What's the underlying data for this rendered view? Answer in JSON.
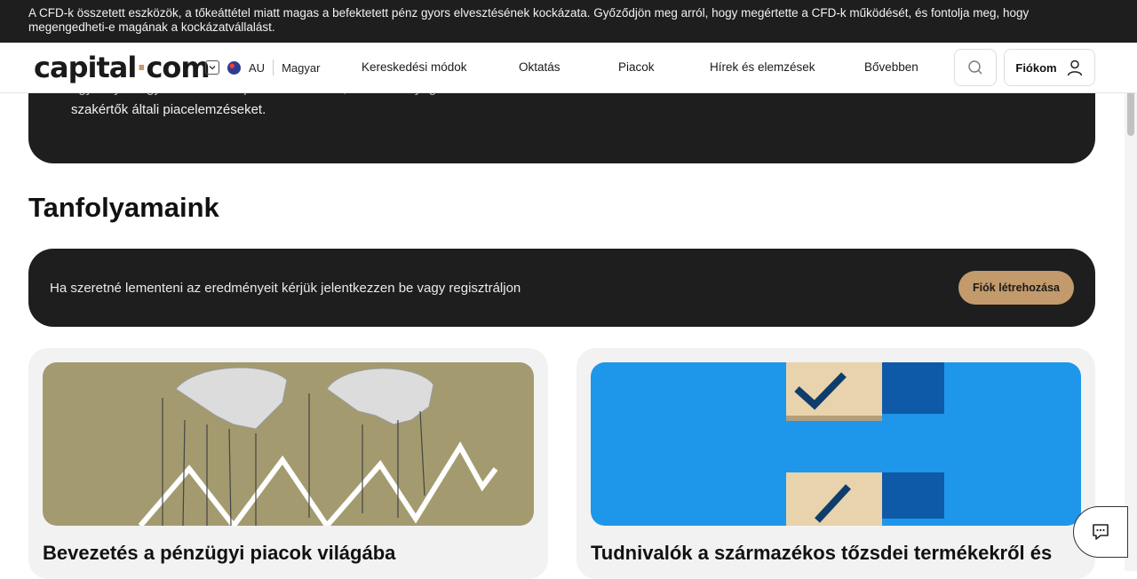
{
  "risk_banner": {
    "text": "A CFD-k összetett eszközök, a tőkeáttétel miatt magas a befektetett pénz gyors elvesztésének kockázata. Győződjön meg arról, hogy megértette a CFD-k működését, és fontolja meg, hogy megengedheti-e magának a kockázatvállalást."
  },
  "header": {
    "logo_left": "capital",
    "logo_dot": "·",
    "logo_right": "com",
    "region": "AU",
    "language": "Magyar",
    "nav": [
      "Kereskedési módok",
      "Oktatás",
      "Piacok",
      "Hírek és elemzések",
      "Bővebben"
    ],
    "account_label": "Fiókom"
  },
  "hero": {
    "line_partial": "egy helyen ügyfelei számára piacelemzéseket, oktatási anyagokat és szakértőket",
    "line2": "szakértők általi piacelemzéseket."
  },
  "courses_section": {
    "title": "Tanfolyamaink",
    "login_prompt": "Ha szeretné lementeni az eredményeit kérjük jelentkezzen be vagy regisztráljon",
    "create_account": "Fiók létrehozása",
    "courses": [
      {
        "title": "Bevezetés a pénzügyi piacok világába",
        "image": "puppet-hands-chart"
      },
      {
        "title": "Tudnivalók a származékos tőzsdei termékekről és",
        "image": "checkbox-ticks"
      }
    ]
  },
  "colors": {
    "dark": "#1e1e1e",
    "accent": "#c39a6b",
    "card_bg": "#f2f2f2",
    "course1_bg": "#a39b6f",
    "course2_bg": "#1e97ea"
  },
  "icons": [
    "chevron-down-icon",
    "australia-flag-icon",
    "search-icon",
    "user-icon",
    "chat-icon"
  ]
}
